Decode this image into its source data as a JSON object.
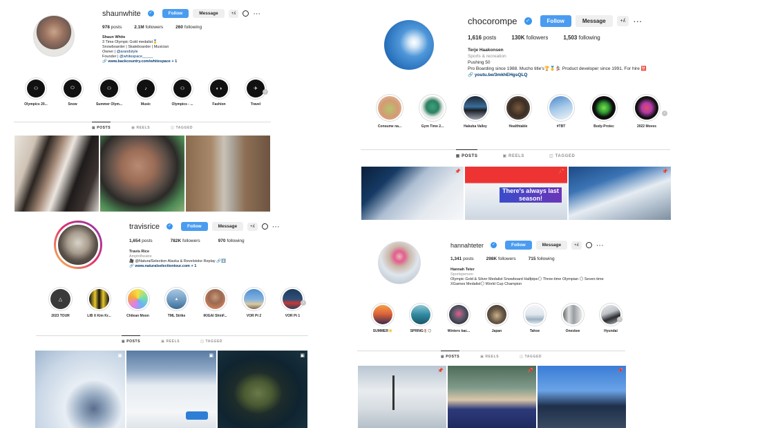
{
  "shared": {
    "follow_label": "Follow",
    "message_label": "Message",
    "add_person_icon": "+⁠⁠ʎ",
    "tabs": [
      "POSTS",
      "REELS",
      "TAGGED"
    ]
  },
  "profiles": [
    {
      "username": "shaunwhite",
      "posts": "978",
      "posts_label": "posts",
      "followers": "2.1M",
      "followers_label": "followers",
      "following": "260",
      "following_label": "following",
      "bio": {
        "name": "Shaun White",
        "line1": "3 Time Olympic Gold medalist🥇",
        "line2": "Snowboarder | Skateboarder | Musician",
        "line3_prefix": "Owner | ",
        "line3_link": "@arandstyle",
        "line4_prefix": "Founder | ",
        "line4_link": "@whitespace_____",
        "website": "www.backcountry.com/whitespace",
        "website_more": "+ 1"
      },
      "highlights": [
        "Olympics 20...",
        "Snow",
        "Summer Olym...",
        "Music",
        "Olympics - ...",
        "Fashion",
        "Travel"
      ]
    },
    {
      "username": "chocorompe",
      "posts": "1,616",
      "posts_label": "posts",
      "followers": "130K",
      "followers_label": "followers",
      "following": "1,503",
      "following_label": "following",
      "bio": {
        "name": "Terje Haakonsen",
        "category": "Sports & recreation",
        "line1": "Pushing 50",
        "line2": "Pro Boarding since 1988. Mucho title's🏆🥇🏂 Product developer since 1991. For hire 🈲",
        "website": "youtu.be/3mkhEHgsQLQ"
      },
      "highlights": [
        "Consume na...",
        "Gym Time 2...",
        "Hakuba Valley",
        "Healthtable",
        "#TBT",
        "Body-Protec",
        "2022 Moves"
      ],
      "tile_text": "There's always last season!"
    },
    {
      "username": "travisrice",
      "posts": "1,654",
      "posts_label": "posts",
      "followers": "782K",
      "followers_label": "followers",
      "following": "970",
      "following_label": "following",
      "bio": {
        "name": "Travis Rice",
        "category": "Amphitheatre",
        "line1": "🎥 @NaturalSelection Alaska & Revelstoke Replay 🔗⬇️",
        "website": "www.naturalselectiontour.com",
        "website_more": "+ 1"
      },
      "highlights": [
        "2023 TOUR",
        "LIB X Kim Kr...",
        "Chilean Moon",
        "TML Strike",
        "IKIGAI ShinF...",
        "VOR Pt 2",
        "VOR Pt 1"
      ]
    },
    {
      "username": "hannahteter",
      "posts": "1,341",
      "posts_label": "posts",
      "followers": "298K",
      "followers_label": "followers",
      "following": "715",
      "following_label": "following",
      "bio": {
        "name": "Hannah Teter",
        "category": "Sportsperson",
        "line1": "Olympic Gold & Silver Medalist Snowboard Halfpipe🌕 Three-time Olympian 🌕 Seven-time",
        "line2": "XGames Medalist🌕 World Cup Champion"
      },
      "highlights": [
        "SUMMER☀️",
        "SPRING🌷🌕",
        "Winters bac...",
        "Japan",
        "Tahoe",
        "Oneskee",
        "Hyundai"
      ]
    }
  ]
}
